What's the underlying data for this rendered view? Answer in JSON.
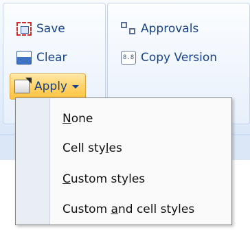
{
  "ribbon": {
    "save": {
      "label": "Save",
      "icon": "save-icon"
    },
    "clear": {
      "label": "Clear",
      "icon": "clear-icon"
    },
    "apply": {
      "label": "Apply",
      "icon": "apply-icon"
    },
    "approvals": {
      "label": "Approvals",
      "icon": "approvals-icon"
    },
    "copy_version": {
      "label": "Copy Version",
      "icon": "copy-version-icon",
      "icon_text": "8.8"
    }
  },
  "apply_menu": {
    "items": [
      {
        "pre": "",
        "key": "N",
        "post": "one"
      },
      {
        "pre": "Cell sty",
        "key": "l",
        "post": "es"
      },
      {
        "pre": "",
        "key": "C",
        "post": "ustom styles"
      },
      {
        "pre": "Custom ",
        "key": "a",
        "post": "nd cell styles"
      }
    ]
  },
  "colors": {
    "ribbon_text": "#15428b",
    "apply_highlight": "#ffd36a",
    "menu_text": "#111111"
  }
}
